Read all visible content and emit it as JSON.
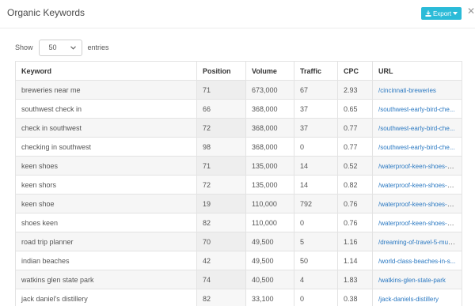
{
  "modal": {
    "title": "Organic Keywords",
    "export_label": "Export",
    "close_glyph": "✕"
  },
  "length_control": {
    "prefix": "Show",
    "value": "50",
    "suffix": "entries"
  },
  "table": {
    "headers": [
      "Keyword",
      "Position",
      "Volume",
      "Traffic",
      "CPC",
      "URL"
    ],
    "rows": [
      {
        "keyword": "breweries near me",
        "position": "71",
        "volume": "673,000",
        "traffic": "67",
        "cpc": "2.93",
        "url": "/cincinnati-breweries"
      },
      {
        "keyword": "southwest check in",
        "position": "66",
        "volume": "368,000",
        "traffic": "37",
        "cpc": "0.65",
        "url": "/southwest-early-bird-che..."
      },
      {
        "keyword": "check in southwest",
        "position": "72",
        "volume": "368,000",
        "traffic": "37",
        "cpc": "0.77",
        "url": "/southwest-early-bird-che..."
      },
      {
        "keyword": "checking in southwest",
        "position": "98",
        "volume": "368,000",
        "traffic": "0",
        "cpc": "0.77",
        "url": "/southwest-early-bird-che..."
      },
      {
        "keyword": "keen shoes",
        "position": "71",
        "volume": "135,000",
        "traffic": "14",
        "cpc": "0.52",
        "url": "/waterproof-keen-shoes-re..."
      },
      {
        "keyword": "keen shors",
        "position": "72",
        "volume": "135,000",
        "traffic": "14",
        "cpc": "0.82",
        "url": "/waterproof-keen-shoes-re..."
      },
      {
        "keyword": "keen shoe",
        "position": "19",
        "volume": "110,000",
        "traffic": "792",
        "cpc": "0.76",
        "url": "/waterproof-keen-shoes-re..."
      },
      {
        "keyword": "shoes keen",
        "position": "82",
        "volume": "110,000",
        "traffic": "0",
        "cpc": "0.76",
        "url": "/waterproof-keen-shoes-re..."
      },
      {
        "keyword": "road trip planner",
        "position": "70",
        "volume": "49,500",
        "traffic": "5",
        "cpc": "1.16",
        "url": "/dreaming-of-travel-5-mus..."
      },
      {
        "keyword": "indian beaches",
        "position": "42",
        "volume": "49,500",
        "traffic": "50",
        "cpc": "1.14",
        "url": "/world-class-beaches-in-s..."
      },
      {
        "keyword": "watkins glen state park",
        "position": "74",
        "volume": "40,500",
        "traffic": "4",
        "cpc": "1.83",
        "url": "/watkins-glen-state-park"
      },
      {
        "keyword": "jack daniel's distillery",
        "position": "82",
        "volume": "33,100",
        "traffic": "0",
        "cpc": "0.38",
        "url": "/jack-daniels-distillery"
      }
    ]
  },
  "colors": {
    "accent": "#2bbbd8",
    "link": "#2b79c2"
  },
  "icons": {
    "export": "download-icon",
    "export_caret": "caret-down-icon",
    "close": "close-icon",
    "select_caret": "chevron-down-icon"
  }
}
